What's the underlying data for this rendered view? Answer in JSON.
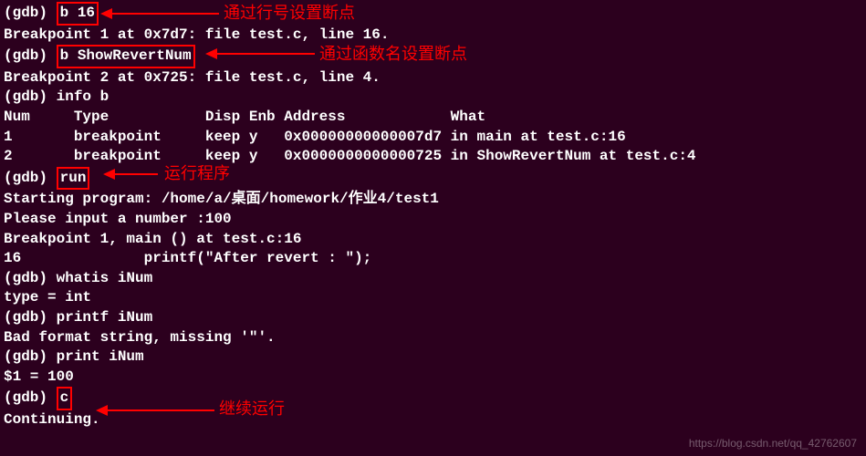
{
  "terminal": {
    "prompt": "(gdb) ",
    "line1_cmd": "b 16",
    "line2": "Breakpoint 1 at 0x7d7: file test.c, line 16.",
    "line3_cmd": "b ShowRevertNum",
    "line4": "Breakpoint 2 at 0x725: file test.c, line 4.",
    "line5": "(gdb) info b",
    "line6": "Num     Type           Disp Enb Address            What",
    "line7": "1       breakpoint     keep y   0x00000000000007d7 in main at test.c:16",
    "line8": "2       breakpoint     keep y   0x0000000000000725 in ShowRevertNum at test.c:4",
    "line9_cmd": "run",
    "line10": "Starting program: /home/a/桌面/homework/作业4/test1",
    "line11": "Please input a number :100",
    "line12": "",
    "line13": "Breakpoint 1, main () at test.c:16",
    "line14": "16              printf(\"After revert : \");",
    "line15": "(gdb) whatis iNum",
    "line16": "type = int",
    "line17": "(gdb) printf iNum",
    "line18": "Bad format string, missing '\"'.",
    "line19": "(gdb) print iNum",
    "line20": "$1 = 100",
    "line21_cmd": "c",
    "line22": "Continuing."
  },
  "annotations": {
    "a1": "通过行号设置断点",
    "a2": "通过函数名设置断点",
    "a3": "运行程序",
    "a4": "继续运行"
  },
  "watermark": "https://blog.csdn.net/qq_42762607"
}
